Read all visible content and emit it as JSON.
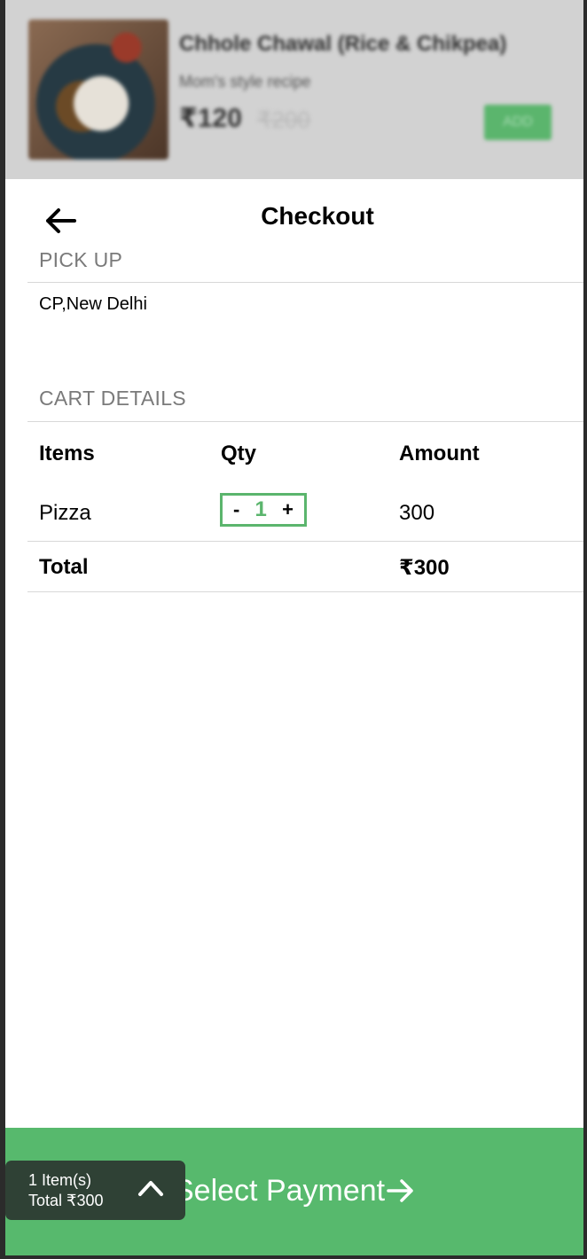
{
  "background_card": {
    "title": "Chhole Chawal (Rice & Chikpea)",
    "subtitle": "Mom's style recipe",
    "price": "₹120",
    "original_price": "₹200",
    "add_label": "ADD"
  },
  "header": {
    "title": "Checkout",
    "back_icon": "arrow-left-icon"
  },
  "pickup": {
    "label": "PICK UP",
    "address": "CP,New Delhi"
  },
  "cart": {
    "label": "CART DETAILS",
    "columns": [
      "Items",
      "Qty",
      "Amount"
    ],
    "items": [
      {
        "name": "Pizza",
        "qty": "1",
        "amount": "300",
        "minus": "-",
        "plus": "+"
      }
    ],
    "total_label": "Total",
    "total_value": "₹300"
  },
  "footer": {
    "items_count": "1 Item(s)",
    "total": "Total ₹300",
    "pay_label": "Select Payment",
    "chevron_icon": "chevron-up-icon",
    "arrow_icon": "arrow-right-icon"
  },
  "colors": {
    "accent": "#57b96d",
    "pill": "#2f4135",
    "muted_label": "#7a7a7a"
  }
}
